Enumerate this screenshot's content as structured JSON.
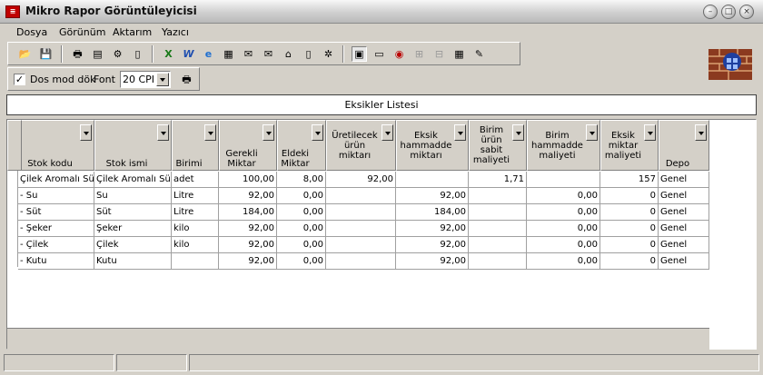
{
  "window": {
    "title": "Mikro Rapor Görüntüleyicisi"
  },
  "menu": [
    "Dosya",
    "Görünüm",
    "Aktarım",
    "Yazıcı"
  ],
  "toolbar2": {
    "checkbox_label": "Dos mod dök",
    "checked": true,
    "font_label": "Font",
    "font_value": "20 CPI"
  },
  "report": {
    "title": "Eksikler Listesi"
  },
  "columns": [
    "Stok kodu",
    "Stok ismi",
    "Birimi",
    "Gerekli Miktar",
    "Eldeki Miktar",
    "Üretilecek ürün miktarı",
    "Eksik hammadde miktarı",
    "Birim ürün sabit maliyeti",
    "Birim hammadde maliyeti",
    "Eksik miktar maliyeti",
    "Depo"
  ],
  "rows": [
    [
      "Çilek Aromalı Süt",
      "Çilek Aromalı Süt",
      "adet",
      "100,00",
      "8,00",
      "92,00",
      "",
      "1,71",
      "",
      "157",
      "Genel"
    ],
    [
      "- Su",
      "Su",
      "Litre",
      "92,00",
      "0,00",
      "",
      "92,00",
      "",
      "0,00",
      "0",
      "Genel"
    ],
    [
      "- Süt",
      "Süt",
      "Litre",
      "184,00",
      "0,00",
      "",
      "184,00",
      "",
      "0,00",
      "0",
      "Genel"
    ],
    [
      "- Şeker",
      "Şeker",
      "kilo",
      "92,00",
      "0,00",
      "",
      "92,00",
      "",
      "0,00",
      "0",
      "Genel"
    ],
    [
      "- Çilek",
      "Çilek",
      "kilo",
      "92,00",
      "0,00",
      "",
      "92,00",
      "",
      "0,00",
      "0",
      "Genel"
    ],
    [
      "- Kutu",
      "Kutu",
      "",
      "92,00",
      "0,00",
      "",
      "92,00",
      "",
      "0,00",
      "0",
      "Genel"
    ]
  ]
}
